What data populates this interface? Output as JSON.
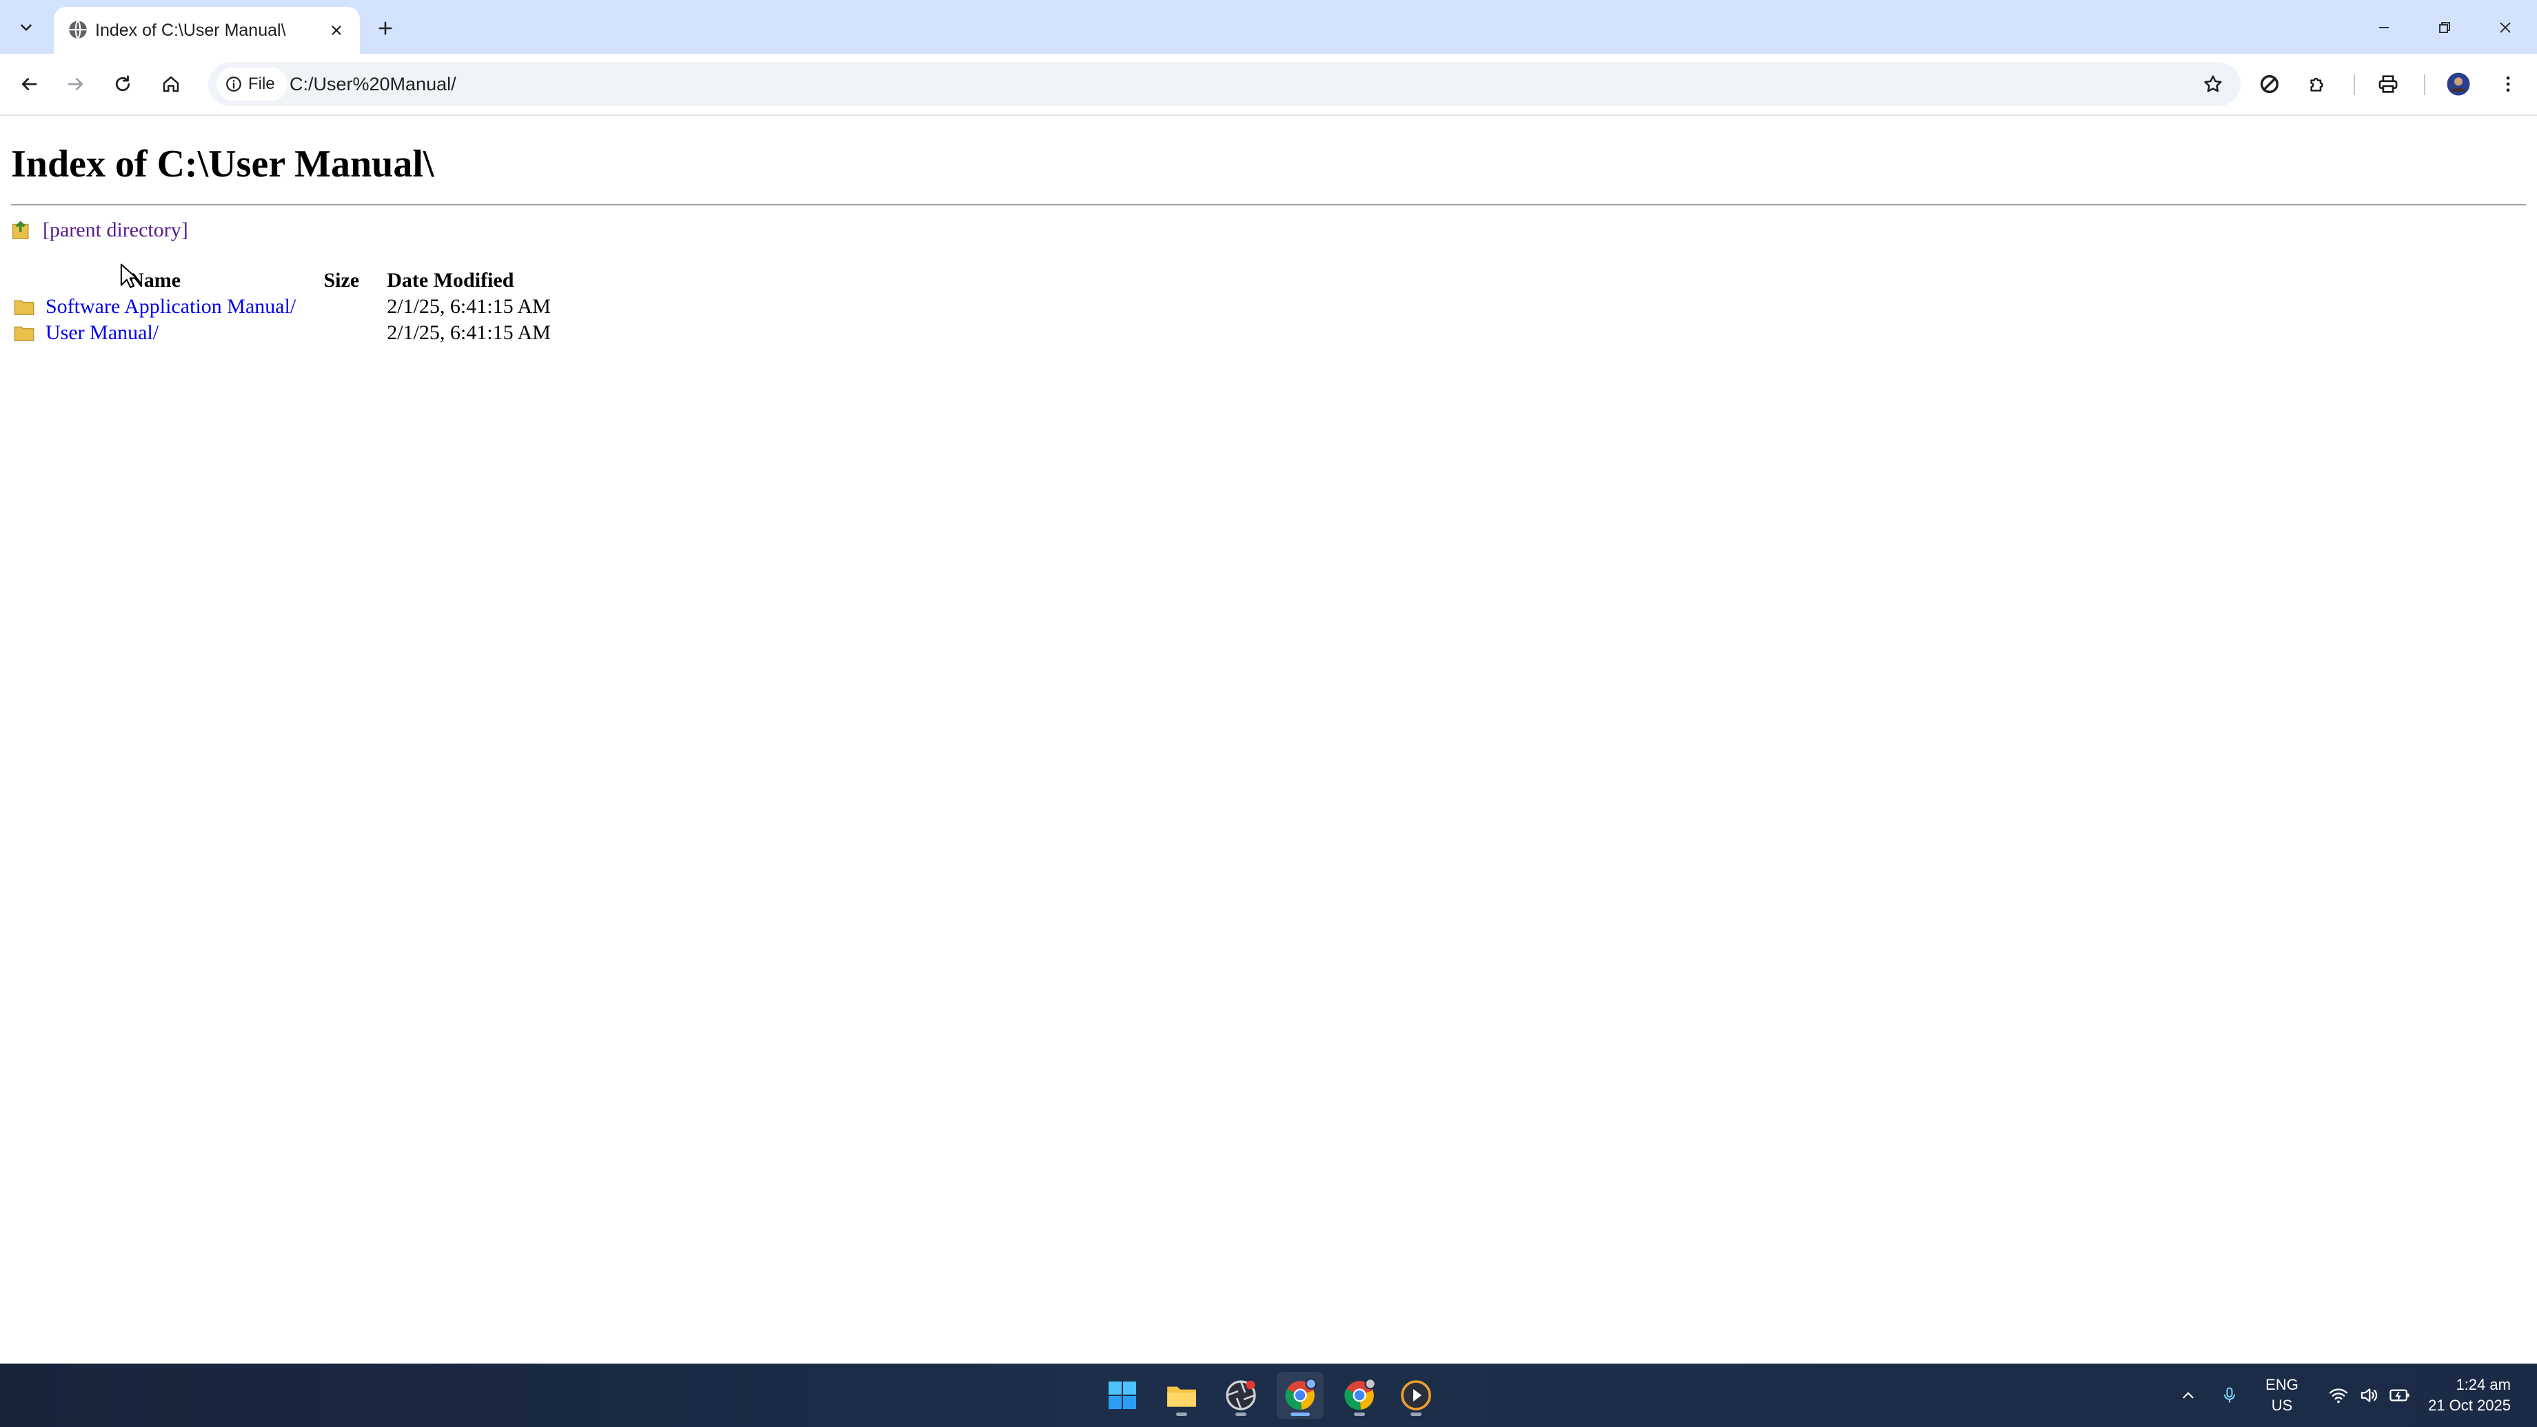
{
  "browser": {
    "tab_title": "Index of C:\\User Manual\\",
    "security_chip_label": "File",
    "url": "C:/User%20Manual/"
  },
  "page": {
    "heading": "Index of C:\\User Manual\\",
    "parent_link": "[parent directory]",
    "columns": {
      "name": "Name",
      "size": "Size",
      "date": "Date Modified"
    },
    "entries": [
      {
        "name": "Software Application Manual/",
        "size": "",
        "date": "2/1/25, 6:41:15 AM"
      },
      {
        "name": "User Manual/",
        "size": "",
        "date": "2/1/25, 6:41:15 AM"
      }
    ]
  },
  "taskbar": {
    "language": "ENG",
    "region": "US",
    "time": "1:24 am",
    "date": "21 Oct 2025"
  },
  "colors": {
    "tabstrip": "#d3e3fd",
    "link": "#0000ee",
    "visited_link": "#551a8b",
    "taskbar": "#1b2b45"
  }
}
